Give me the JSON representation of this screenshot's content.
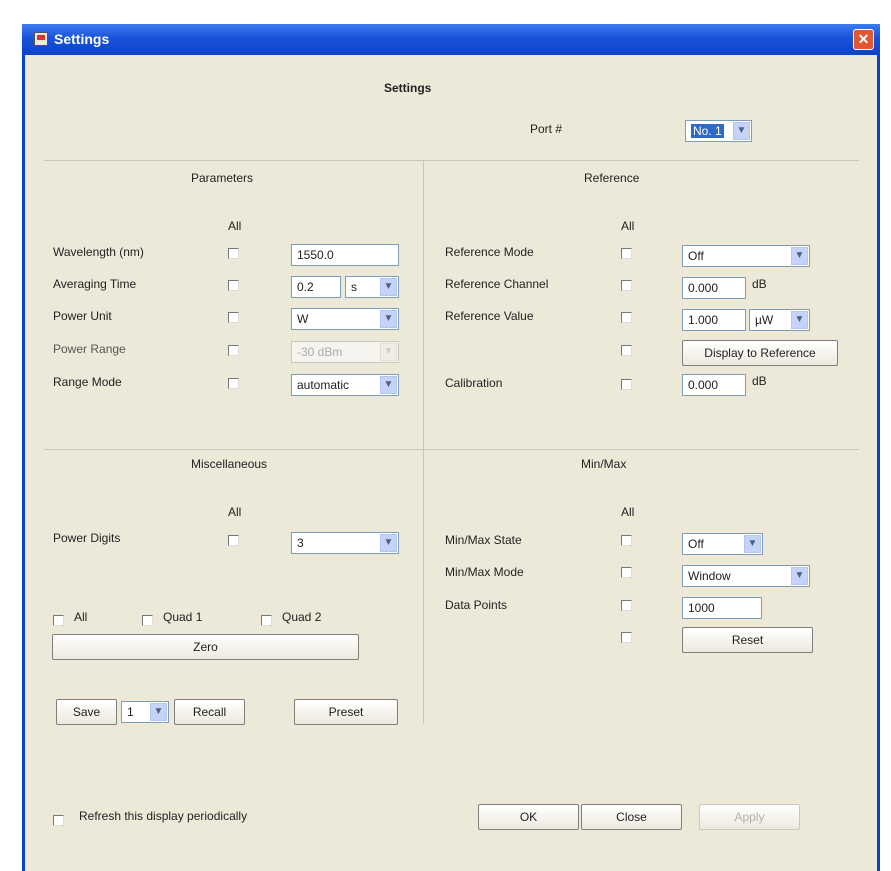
{
  "window": {
    "title": "Settings",
    "close_glyph": "✕"
  },
  "header": {
    "title": "Settings",
    "port_label": "Port #",
    "port_value": "No. 1"
  },
  "parameters": {
    "title": "Parameters",
    "all_label": "All",
    "wavelength_label": "Wavelength (nm)",
    "wavelength_value": "1550.0",
    "averaging_label": "Averaging Time",
    "averaging_value": "0.2",
    "averaging_unit": "s",
    "power_unit_label": "Power Unit",
    "power_unit_value": "W",
    "power_range_label": "Power Range",
    "power_range_value": "-30 dBm",
    "range_mode_label": "Range Mode",
    "range_mode_value": "automatic"
  },
  "reference": {
    "title": "Reference",
    "all_label": "All",
    "mode_label": "Reference Mode",
    "mode_value": "Off",
    "channel_label": "Reference Channel",
    "channel_value": "0.000",
    "channel_unit": "dB",
    "value_label": "Reference Value",
    "value_value": "1.000",
    "value_unit": "µW",
    "display_to_ref_button": "Display to Reference",
    "calibration_label": "Calibration",
    "calibration_value": "0.000",
    "calibration_unit": "dB"
  },
  "misc": {
    "title": "Miscellaneous",
    "all_label": "All",
    "power_digits_label": "Power Digits",
    "power_digits_value": "3",
    "zero_all_label": "All",
    "quad1_label": "Quad 1",
    "quad2_label": "Quad 2",
    "zero_button": "Zero",
    "save_button": "Save",
    "slot_value": "1",
    "recall_button": "Recall",
    "preset_button": "Preset"
  },
  "minmax": {
    "title": "Min/Max",
    "all_label": "All",
    "state_label": "Min/Max State",
    "state_value": "Off",
    "mode_label": "Min/Max Mode",
    "mode_value": "Window",
    "points_label": "Data Points",
    "points_value": "1000",
    "reset_button": "Reset"
  },
  "footer": {
    "refresh_label": "Refresh this display periodically",
    "ok_button": "OK",
    "close_button": "Close",
    "apply_button": "Apply"
  },
  "icons": {
    "dropdown": "▼"
  }
}
